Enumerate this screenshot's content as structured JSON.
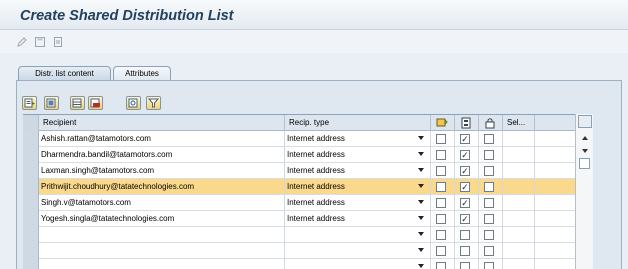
{
  "window": {
    "title": "Create Shared Distribution List"
  },
  "toolbar": {
    "icons": [
      "pencil-icon",
      "save-icon",
      "print-icon"
    ]
  },
  "tabs": [
    {
      "label": "Distr. list content",
      "active": true
    },
    {
      "label": "Attributes",
      "active": false
    }
  ],
  "grid_toolbar": {
    "icons": [
      "details-icon",
      "select-all-icon",
      "insert-row-icon",
      "delete-row-icon",
      "find-icon",
      "filter-icon"
    ]
  },
  "table": {
    "headers": {
      "recipient": "Recipient",
      "recip_type": "Recip. type",
      "col_express": "express-mail-icon",
      "col_copy": "copy-icon",
      "col_blind": "lock-icon",
      "col_sel": "Sel..."
    },
    "rows": [
      {
        "recipient": "Ashish.rattan@tatamotors.com",
        "recip_type": "Internet address",
        "express": false,
        "copy": true,
        "blind": false
      },
      {
        "recipient": "Dharmendra.bandil@tatamotors.com",
        "recip_type": "Internet address",
        "express": false,
        "copy": true,
        "blind": false
      },
      {
        "recipient": "Laxman.singh@tatamotors.com",
        "recip_type": "Internet address",
        "express": false,
        "copy": true,
        "blind": false
      },
      {
        "recipient": "Prithwijit.choudhury@tatatechnologies.com",
        "recip_type": "Internet address",
        "express": false,
        "copy": true,
        "blind": false,
        "selected": true
      },
      {
        "recipient": "Singh.v@tatamotors.com",
        "recip_type": "Internet address",
        "express": false,
        "copy": true,
        "blind": false
      },
      {
        "recipient": "Yogesh.singla@tatatechnologies.com",
        "recip_type": "Internet address",
        "express": false,
        "copy": true,
        "blind": false
      },
      {
        "recipient": "",
        "recip_type": "",
        "express": false,
        "copy": false,
        "blind": false
      },
      {
        "recipient": "",
        "recip_type": "",
        "express": false,
        "copy": false,
        "blind": false
      },
      {
        "recipient": "",
        "recip_type": "",
        "express": false,
        "copy": false,
        "blind": false
      }
    ]
  },
  "colors": {
    "selected_row": "#fbd98c",
    "title": "#23415f"
  }
}
